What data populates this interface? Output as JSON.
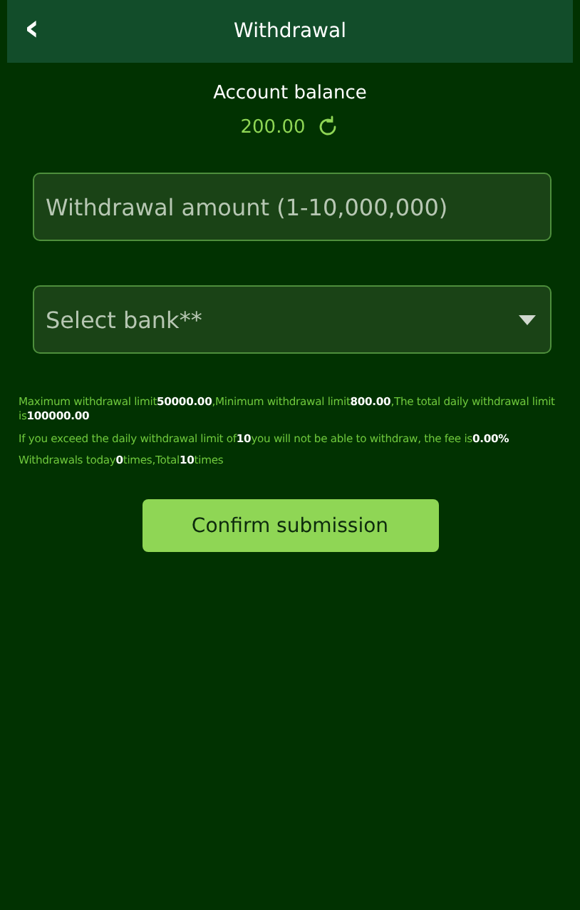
{
  "header": {
    "back_icon": "‹",
    "title": "Withdrawal"
  },
  "balance": {
    "label": "Account balance",
    "amount": "200.00"
  },
  "amount_field": {
    "placeholder": "Withdrawal amount (1-10,000,000)"
  },
  "bank_select": {
    "placeholder": "Select bank**"
  },
  "notes": [
    "Maximum withdrawal limit**50000.00**,Minimum withdrawal limit**800.00**,The total daily withdrawal limit is**100000.00**",
    "If you exceed the daily withdrawal limit of**10**you will not be able to withdraw, the fee is**0.00%**",
    "Withdrawals today**0**times,Total**10**times"
  ],
  "submit_button": "Confirm submission"
}
